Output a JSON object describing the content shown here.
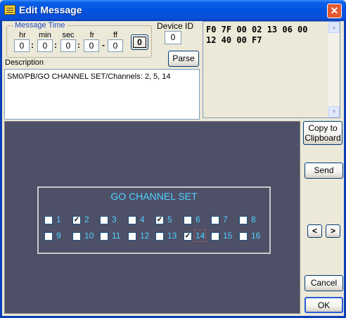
{
  "window": {
    "title": "Edit Message",
    "close_glyph": "✕",
    "title_icon": "message-icon"
  },
  "time": {
    "group_label": "Message Time",
    "fields": [
      {
        "label": "hr",
        "value": "0"
      },
      {
        "label": "min",
        "value": "0"
      },
      {
        "label": "sec",
        "value": "0"
      },
      {
        "label": "fr",
        "value": "0"
      },
      {
        "label": "ff",
        "value": "0"
      }
    ],
    "separators": [
      ":",
      ":",
      ":",
      "-"
    ],
    "zero_button": "0"
  },
  "device": {
    "label": "Device ID",
    "value": "0"
  },
  "parse_button": "Parse",
  "description": {
    "label": "Description",
    "text": "SM0/PB/GO CHANNEL SET/Channels: 2, 5, 14"
  },
  "hex": {
    "line1": "F0 7F 00 02 13 06 00",
    "line2": "12 40 00 F7"
  },
  "buttons": {
    "copy_line1": "Copy to",
    "copy_line2": "Clipboard",
    "send": "Send",
    "prev": "<",
    "next": ">",
    "cancel": "Cancel",
    "ok": "OK"
  },
  "channels": {
    "title": "GO CHANNEL SET",
    "items": [
      {
        "label": "1",
        "checked": false
      },
      {
        "label": "2",
        "checked": true
      },
      {
        "label": "3",
        "checked": false
      },
      {
        "label": "4",
        "checked": false
      },
      {
        "label": "5",
        "checked": true
      },
      {
        "label": "6",
        "checked": false
      },
      {
        "label": "7",
        "checked": false
      },
      {
        "label": "8",
        "checked": false
      },
      {
        "label": "9",
        "checked": false
      },
      {
        "label": "10",
        "checked": false
      },
      {
        "label": "11",
        "checked": false
      },
      {
        "label": "12",
        "checked": false
      },
      {
        "label": "13",
        "checked": false
      },
      {
        "label": "14",
        "checked": true
      },
      {
        "label": "15",
        "checked": false
      },
      {
        "label": "16",
        "checked": false
      }
    ],
    "check_glyph": "✓"
  },
  "colors": {
    "panel_bg": "#4e5068",
    "channel_text": "#4fd0ff",
    "title_bar": "#0053e1"
  }
}
